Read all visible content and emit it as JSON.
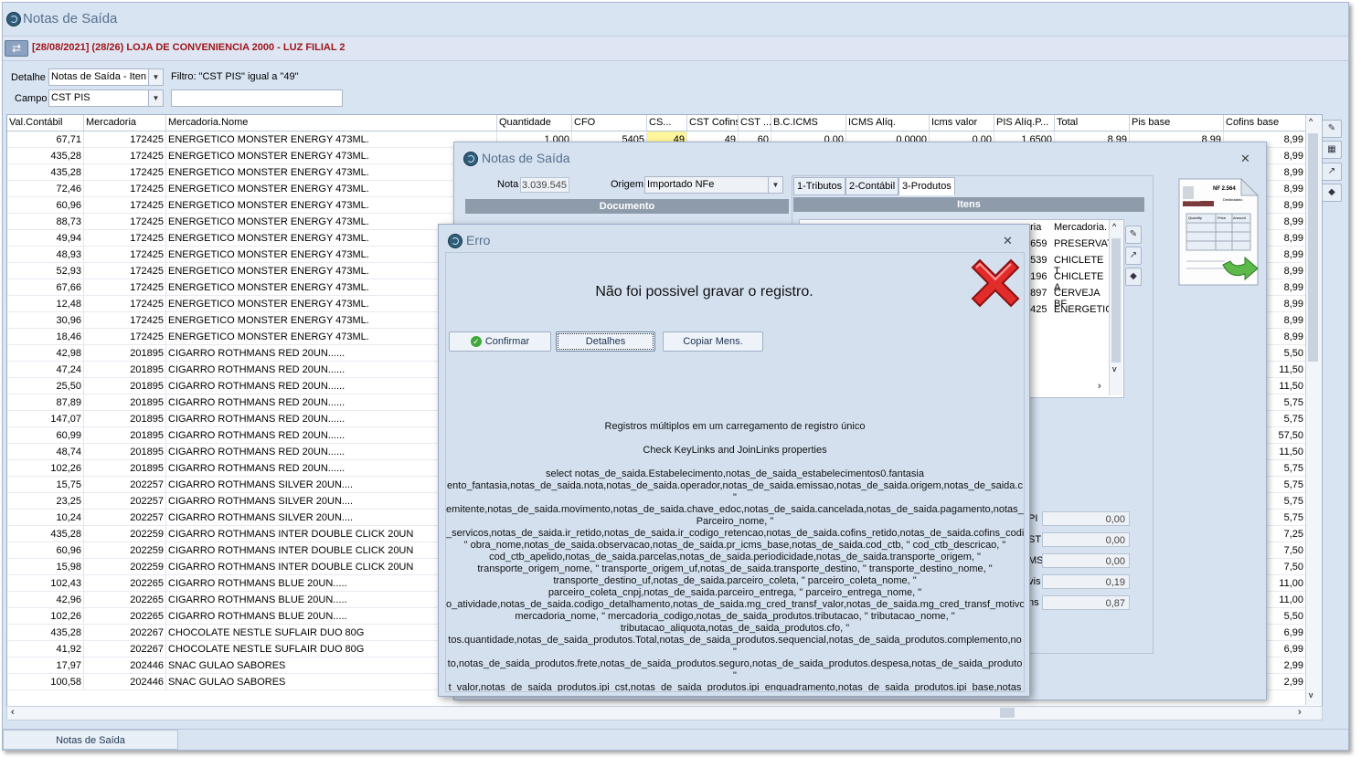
{
  "window": {
    "title": "Notas de Saída"
  },
  "header": {
    "context": "[28/08/2021] (28/26) LOJA DE CONVENIENCIA 2000 - LUZ  FILIAL 2"
  },
  "filters": {
    "detalhe_label": "Detalhe",
    "detalhe_value": "Notas de Saída - Iten",
    "filtro_text": "Filtro: \"CST PIS\" igual a \"49\"",
    "campo_label": "Campo",
    "campo_value": "CST PIS",
    "search_value": ""
  },
  "grid": {
    "columns": [
      "Val.Contábil",
      "Mercadoria",
      "Mercadoria.Nome",
      "Quantidade",
      "CFO",
      "CS...",
      "CST Cofins",
      "CST ...",
      "B.C.ICMS",
      "ICMS Alíq.",
      "Icms valor",
      "PIS Alíq.P...",
      "Total",
      "Pis base",
      "Cofins base"
    ],
    "first_row_extra": {
      "quantidade": "1,000",
      "cfo": "5405",
      "cst": "49",
      "cst_cofins": "49",
      "cst2": "60",
      "bc_icms": "0,00",
      "icms_aliq": "0,0000",
      "icms_valor": "0,00",
      "pis_aliq": "1,6500",
      "total": "8,99",
      "pis_base": "8,99"
    },
    "rows": [
      [
        "67,71",
        "172425",
        "ENERGETICO MONSTER ENERGY 473ML.",
        "8,99"
      ],
      [
        "435,28",
        "172425",
        "ENERGETICO MONSTER ENERGY 473ML.",
        "8,99"
      ],
      [
        "435,28",
        "172425",
        "ENERGETICO MONSTER ENERGY 473ML.",
        "8,99"
      ],
      [
        "72,46",
        "172425",
        "ENERGETICO MONSTER ENERGY 473ML.",
        "8,99"
      ],
      [
        "60,96",
        "172425",
        "ENERGETICO MONSTER ENERGY 473ML.",
        "8,99"
      ],
      [
        "88,73",
        "172425",
        "ENERGETICO MONSTER ENERGY 473ML.",
        "8,99"
      ],
      [
        "49,94",
        "172425",
        "ENERGETICO MONSTER ENERGY 473ML.",
        "8,99"
      ],
      [
        "48,93",
        "172425",
        "ENERGETICO MONSTER ENERGY 473ML.",
        "8,99"
      ],
      [
        "52,93",
        "172425",
        "ENERGETICO MONSTER ENERGY 473ML.",
        "8,99"
      ],
      [
        "67,66",
        "172425",
        "ENERGETICO MONSTER ENERGY 473ML.",
        "8,99"
      ],
      [
        "12,48",
        "172425",
        "ENERGETICO MONSTER ENERGY 473ML.",
        "8,99"
      ],
      [
        "30,96",
        "172425",
        "ENERGETICO MONSTER ENERGY 473ML.",
        "8,99"
      ],
      [
        "18,46",
        "172425",
        "ENERGETICO MONSTER ENERGY 473ML.",
        "8,99"
      ],
      [
        "42,98",
        "201895",
        "CIGARRO ROTHMANS RED 20UN......",
        "5,50"
      ],
      [
        "47,24",
        "201895",
        "CIGARRO ROTHMANS RED 20UN......",
        "11,50"
      ],
      [
        "25,50",
        "201895",
        "CIGARRO ROTHMANS RED 20UN......",
        "11,50"
      ],
      [
        "87,89",
        "201895",
        "CIGARRO ROTHMANS RED 20UN......",
        "5,75"
      ],
      [
        "147,07",
        "201895",
        "CIGARRO ROTHMANS RED 20UN......",
        "5,75"
      ],
      [
        "60,99",
        "201895",
        "CIGARRO ROTHMANS RED 20UN......",
        "57,50"
      ],
      [
        "48,74",
        "201895",
        "CIGARRO ROTHMANS RED 20UN......",
        "11,50"
      ],
      [
        "102,26",
        "201895",
        "CIGARRO ROTHMANS RED 20UN......",
        "5,75"
      ],
      [
        "15,75",
        "202257",
        "CIGARRO ROTHMANS SILVER 20UN....",
        "5,75"
      ],
      [
        "23,25",
        "202257",
        "CIGARRO ROTHMANS SILVER 20UN....",
        "5,75"
      ],
      [
        "10,24",
        "202257",
        "CIGARRO ROTHMANS SILVER 20UN....",
        "5,75"
      ],
      [
        "435,28",
        "202259",
        "CIGARRO ROTHMANS INTER DOUBLE CLICK 20UN",
        "7,25"
      ],
      [
        "60,96",
        "202259",
        "CIGARRO ROTHMANS INTER DOUBLE CLICK 20UN",
        "7,50"
      ],
      [
        "15,98",
        "202259",
        "CIGARRO ROTHMANS INTER DOUBLE CLICK 20UN",
        "7,50"
      ],
      [
        "102,43",
        "202265",
        "CIGARRO ROTHMANS BLUE 20UN.....",
        "11,00"
      ],
      [
        "42,96",
        "202265",
        "CIGARRO ROTHMANS BLUE 20UN.....",
        "11,00"
      ],
      [
        "102,26",
        "202265",
        "CIGARRO ROTHMANS BLUE 20UN.....",
        "5,50"
      ],
      [
        "435,28",
        "202267",
        "CHOCOLATE NESTLE SUFLAIR DUO 80G",
        "6,99"
      ],
      [
        "41,92",
        "202267",
        "CHOCOLATE NESTLE SUFLAIR DUO 80G",
        "6,99"
      ],
      [
        "17,97",
        "202446",
        "SNAC GULAO SABORES",
        "2,99"
      ],
      [
        "100,58",
        "202446",
        "SNAC GULAO SABORES",
        "2,99"
      ]
    ]
  },
  "bottom_tab": {
    "label": "Notas de Saída"
  },
  "note_dialog": {
    "title": "Notas de Saída",
    "nota_label": "Nota",
    "nota_value": "3.039.545",
    "origem_label": "Origem",
    "origem_value": "Importado NFe",
    "documento_header": "Documento",
    "tabs": [
      "1-Tributos",
      "2-Contábil",
      "3-Produtos"
    ],
    "itens_header": "Itens",
    "itens_columns": [
      "oria",
      "Mercadoria."
    ],
    "itens_rows": [
      [
        "7659",
        "PRESERVAT"
      ],
      [
        "3539",
        "CHICLETE T"
      ],
      [
        "3196",
        "CHICLETE A"
      ],
      [
        "2897",
        "CERVEJA BF"
      ],
      [
        "2425",
        "ENERGETIC"
      ]
    ],
    "tax_labels": [
      "PI",
      "ST",
      "MS",
      "vis",
      "ns"
    ],
    "tax_values": [
      "0,00",
      "0,00",
      "0,00",
      "0,19",
      "0,87"
    ],
    "doc_image": {
      "nf_label": "NF 2.564",
      "rem": "Remetente",
      "dest": "Destinatário",
      "q": "Quantity",
      "p": "Price",
      "a": "Amount"
    }
  },
  "error_dialog": {
    "title": "Erro",
    "message": "Não foi possivel gravar o registro.",
    "buttons": {
      "confirm": "Confirmar",
      "details": "Detalhes",
      "copy": "Copiar Mens."
    },
    "details_lines": [
      "Registros múltiplos em um carregamento de registro único",
      "Check KeyLinks and JoinLinks properties",
      "select  notas_de_saida.Estabelecimento,notas_de_saida_estabelecimentos0.fantasia",
      "ento_fantasia,notas_de_saida.nota,notas_de_saida.operador,notas_de_saida.emissao,notas_de_saida.origem,notas_de_saida.c",
      "\"",
      "emitente,notas_de_saida.movimento,notas_de_saida.chave_edoc,notas_de_saida.cancelada,notas_de_saida.pagamento,notas_c",
      "Parceiro_nome, \"",
      "_servicos,notas_de_saida.ir_retido,notas_de_saida.ir_codigo_retencao,notas_de_saida.cofins_retido,notas_de_saida.cofins_codi",
      "\" obra_nome,notas_de_saida.observacao,notas_de_saida.pr_icms_base,notas_de_saida.cod_ctb, \" cod_ctb_descricao, \"",
      "cod_ctb_apelido,notas_de_saida.parcelas,notas_de_saida.periodicidade,notas_de_saida.transporte_origem, \"",
      "transporte_origem_nome, \" transporte_origem_uf,notas_de_saida.transporte_destino, \" transporte_destino_nome, \"",
      "transporte_destino_uf,notas_de_saida.parceiro_coleta, \" parceiro_coleta_nome, \"",
      "parceiro_coleta_cnpj,notas_de_saida.parceiro_entrega, \" parceiro_entrega_nome, \"",
      "o_atividade,notas_de_saida.codigo_detalhamento,notas_de_saida.mg_cred_transf_valor,notas_de_saida.mg_cred_transf_motivo",
      "mercadoria_nome, \" mercadoria_codigo,notas_de_saida_produtos.tributacao, \" tributacao_nome, \"",
      "tributacao_aliquota,notas_de_saida_produtos.cfo, \"",
      "tos.quantidade,notas_de_saida_produtos.Total,notas_de_saida_produtos.sequencial,notas_de_saida_produtos.complemento,no",
      "\"",
      "to,notas_de_saida_produtos.frete,notas_de_saida_produtos.seguro,notas_de_saida_produtos.despesa,notas_de_saida_produto",
      "\"",
      "t_valor,notas_de_saida_produtos.ipi_cst,notas_de_saida_produtos.ipi_enquadramento,notas_de_saida_produtos.ipi_base,notas"
    ]
  },
  "colors": {
    "header_red": "#a0141a",
    "highlight_cell": "#fff59a"
  }
}
